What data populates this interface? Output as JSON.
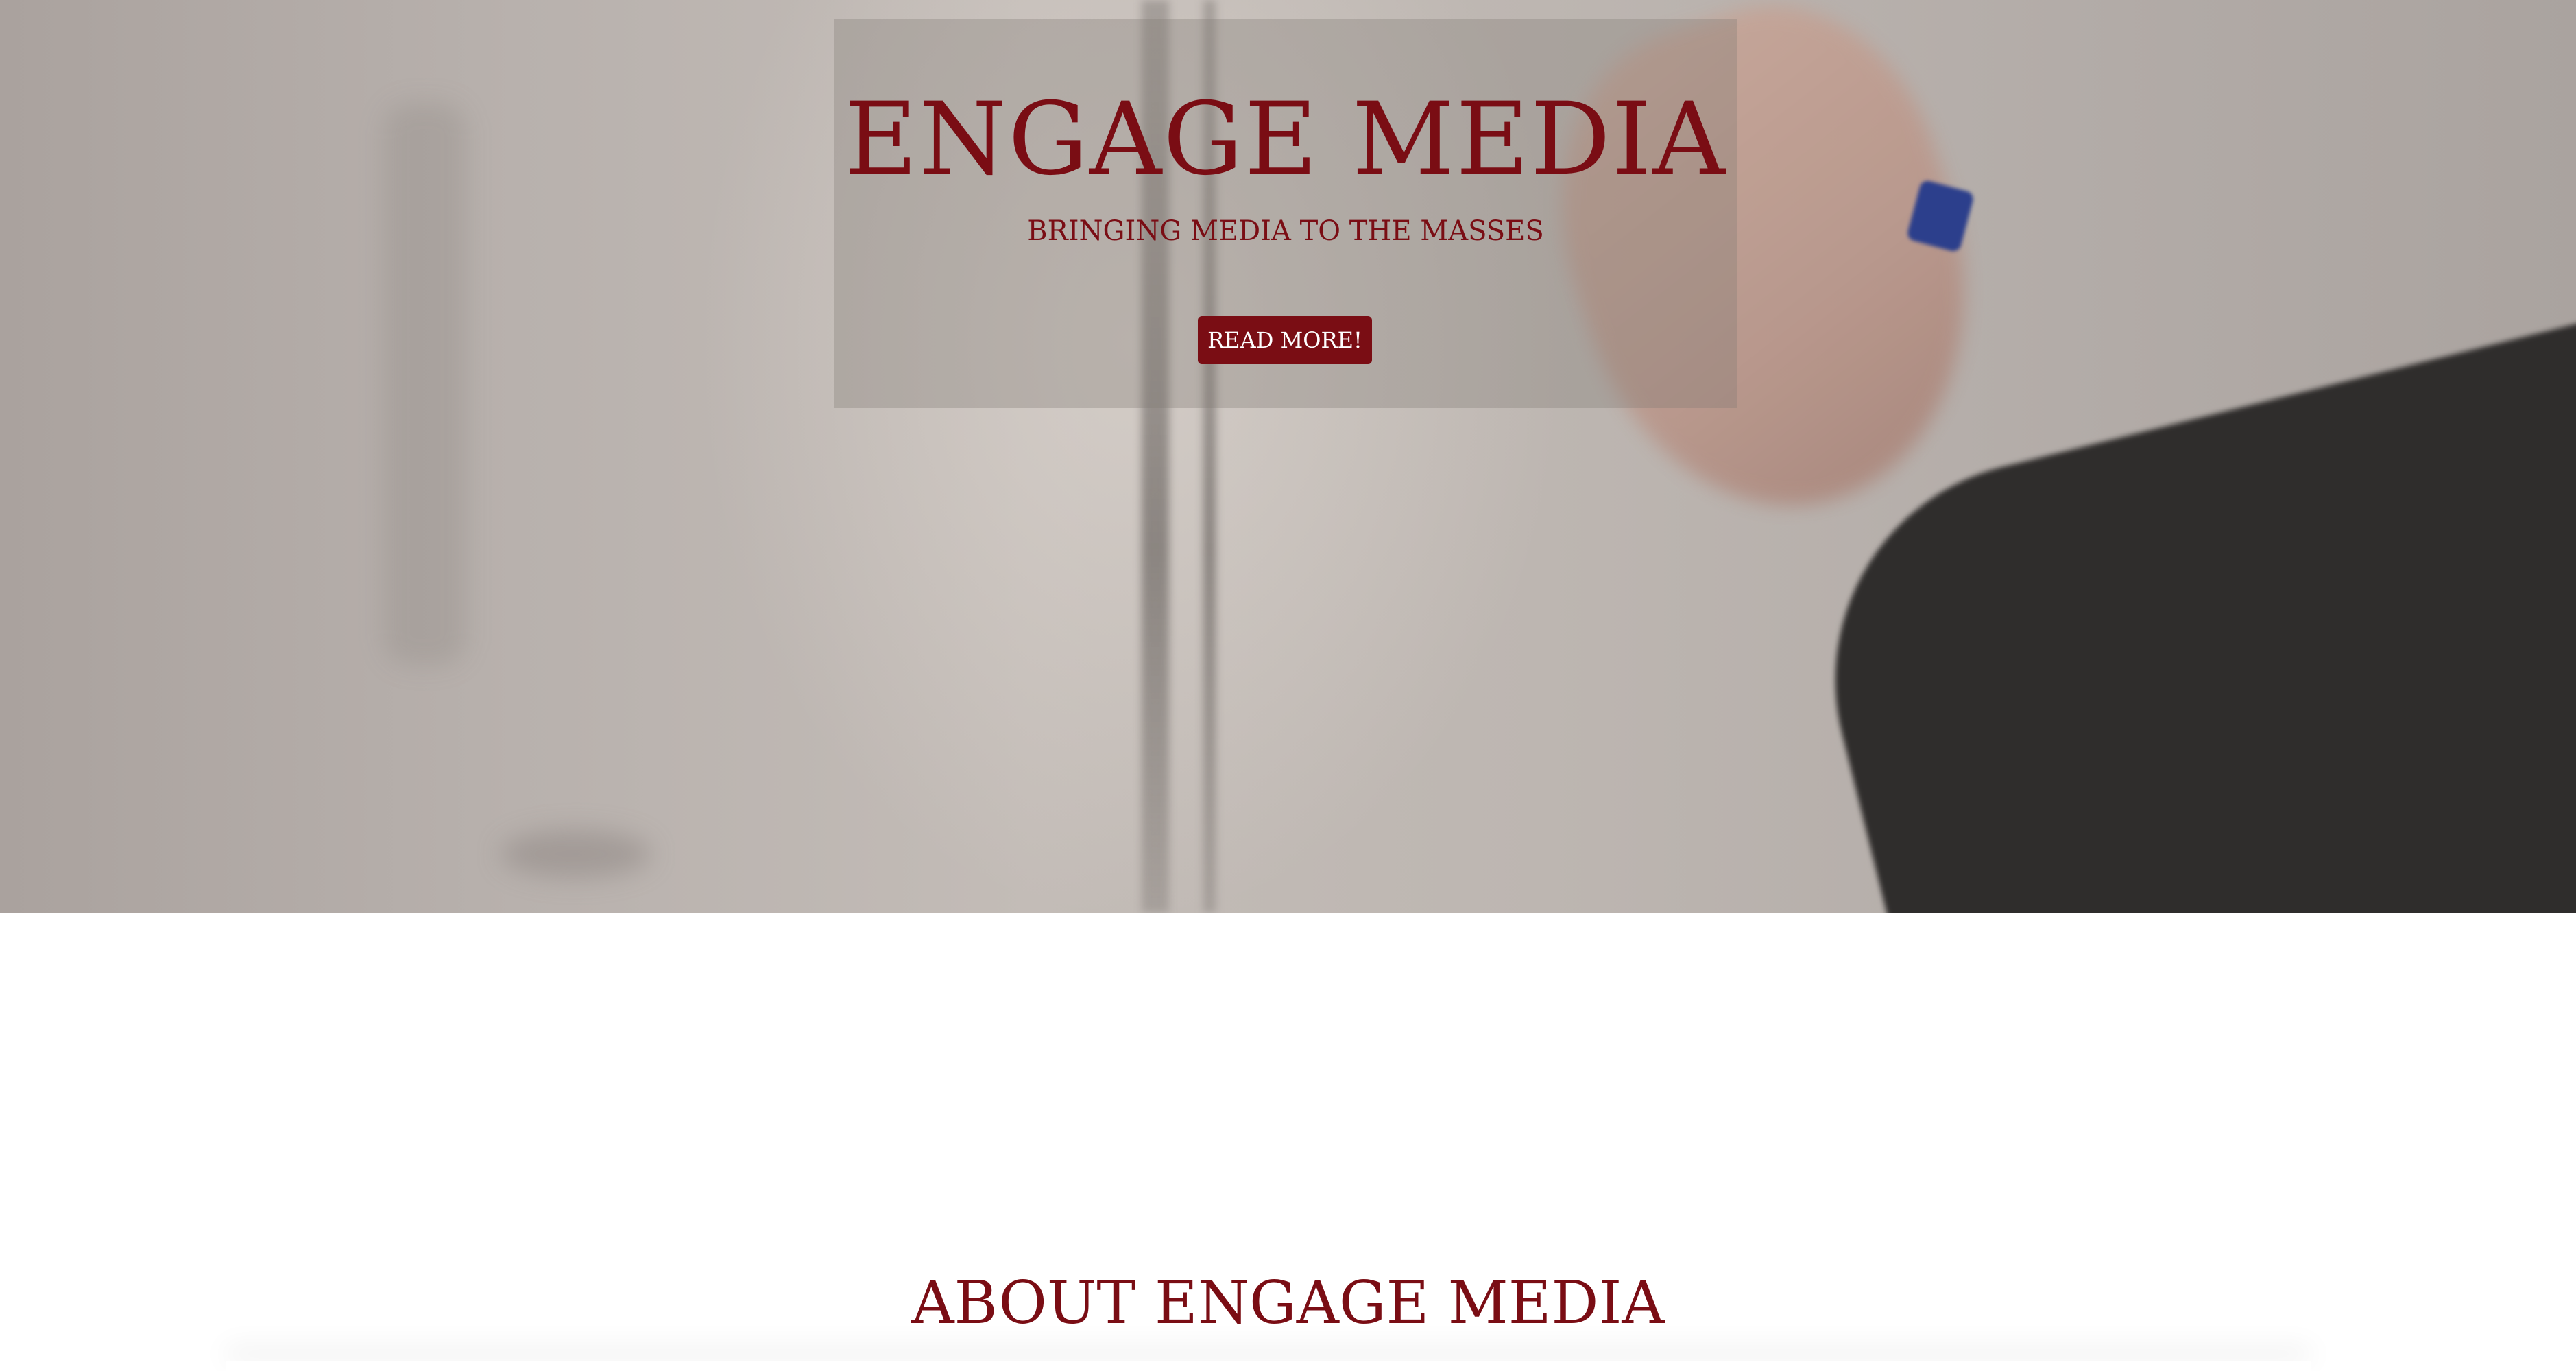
{
  "hero": {
    "title": "ENGAGE MEDIA",
    "subtitle": "BRINGING MEDIA TO THE MASSES",
    "cta_label": "READ MORE!",
    "background_image": "blurred-hand-writing-on-whiteboard"
  },
  "about": {
    "title": "ABOUT ENGAGE MEDIA"
  },
  "colors": {
    "accent": "#7a0d14",
    "button_text": "#ffffff",
    "page_background": "#ffffff"
  }
}
